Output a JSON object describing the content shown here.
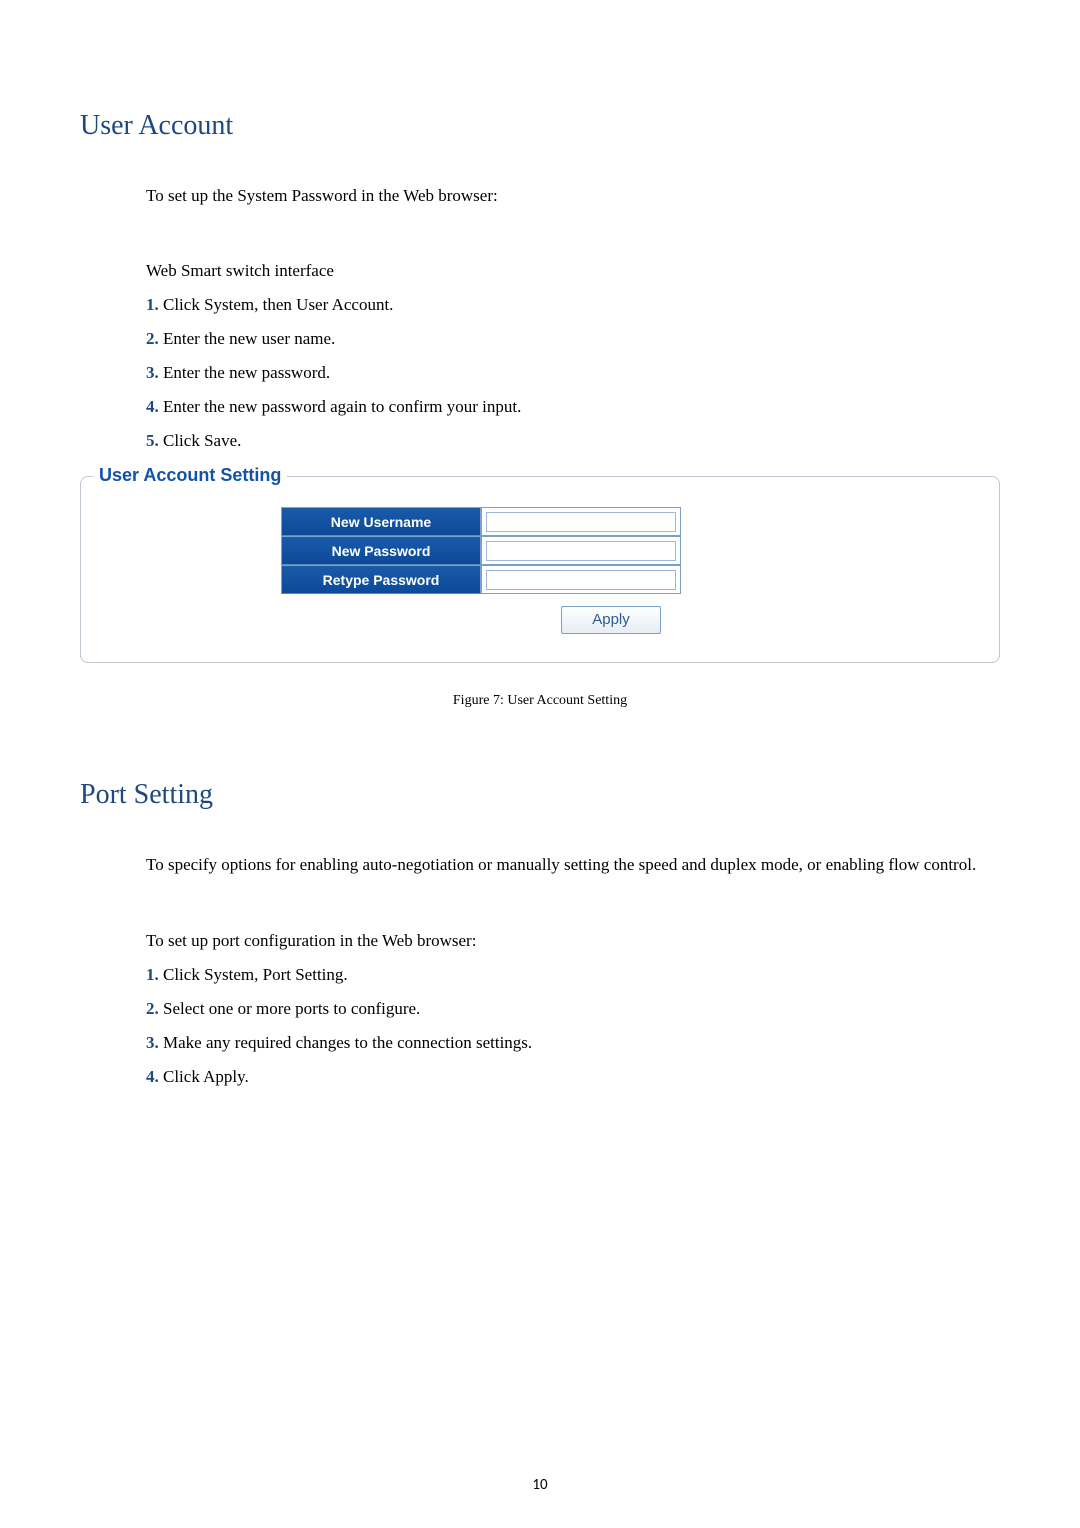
{
  "section1": {
    "heading": "User Account",
    "intro": "To set up the System Password in the Web browser:",
    "interface_line": "Web Smart switch interface",
    "steps": [
      {
        "num": "1.",
        "text": " Click System, then User Account."
      },
      {
        "num": "2.",
        "text": " Enter the new user name."
      },
      {
        "num": "3.",
        "text": " Enter the new password."
      },
      {
        "num": "4.",
        "text": " Enter the new password again to confirm your input."
      },
      {
        "num": "5.",
        "text": " Click Save."
      }
    ]
  },
  "panel": {
    "legend": "User Account Setting",
    "rows": {
      "username": "New Username",
      "password": "New Password",
      "retype": "Retype Password"
    },
    "apply_label": "Apply"
  },
  "figure_caption": "Figure 7: User Account Setting",
  "section2": {
    "heading": "Port Setting",
    "intro": "To specify options for enabling auto-negotiation or manually setting the speed and duplex mode, or enabling flow control.",
    "lead": "To set up port configuration in the Web browser:",
    "steps": [
      {
        "num": "1.",
        "text": " Click System, Port Setting."
      },
      {
        "num": "2.",
        "text": " Select one or more ports to configure."
      },
      {
        "num": "3.",
        "text": " Make any required changes to the connection settings."
      },
      {
        "num": "4.",
        "text": " Click Apply."
      }
    ]
  },
  "page_number": "10"
}
